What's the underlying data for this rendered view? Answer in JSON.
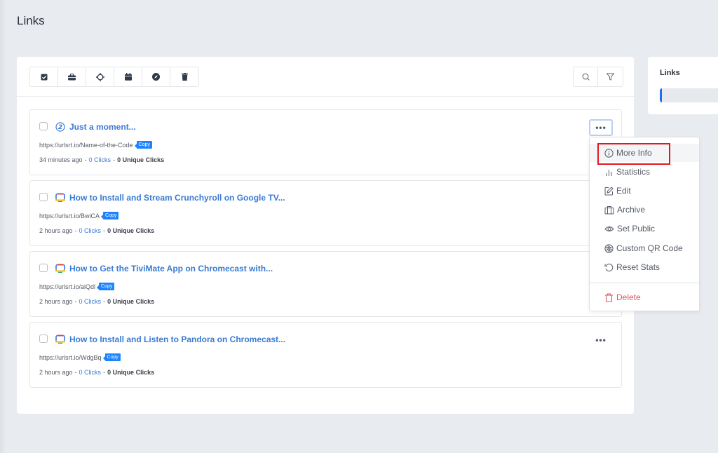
{
  "page": {
    "title": "Links"
  },
  "toolbar": {
    "buttons": [
      {
        "name": "select-all",
        "icon": "checkbox-icon"
      },
      {
        "name": "campaign",
        "icon": "briefcase-icon"
      },
      {
        "name": "pixels",
        "icon": "crosshair-icon"
      },
      {
        "name": "schedule",
        "icon": "calendar-icon"
      },
      {
        "name": "explore",
        "icon": "compass-icon"
      },
      {
        "name": "delete",
        "icon": "trash-icon"
      }
    ],
    "search_icon": "search-icon",
    "filter_icon": "filter-icon"
  },
  "links": [
    {
      "favicon": "custom-circle-icon",
      "title": "Just a moment...",
      "url": "https://urlsrt.io/Name-of-the-Code",
      "copy_label": "Copy",
      "time": "34 minutes ago",
      "clicks": "0 Clicks",
      "unique_clicks": "0 Unique Clicks",
      "menu_open": true
    },
    {
      "favicon": "google-tv-icon",
      "title": "How to Install and Stream Crunchyroll on Google TV...",
      "url": "https://urlsrt.io/BwiCA",
      "copy_label": "Copy",
      "time": "2 hours ago",
      "clicks": "0 Clicks",
      "unique_clicks": "0 Unique Clicks",
      "menu_open": false
    },
    {
      "favicon": "google-tv-icon",
      "title": "How to Get the TiviMate App on Chromecast with...",
      "url": "https://urlsrt.io/aiQdl",
      "copy_label": "Copy",
      "time": "2 hours ago",
      "clicks": "0 Clicks",
      "unique_clicks": "0 Unique Clicks",
      "menu_open": false
    },
    {
      "favicon": "google-tv-icon",
      "title": "How to Install and Listen to Pandora on Chromecast...",
      "url": "https://urlsrt.io/WdgBq",
      "copy_label": "Copy",
      "time": "2 hours ago",
      "clicks": "0 Clicks",
      "unique_clicks": "0 Unique Clicks",
      "menu_open": false
    }
  ],
  "separator": "-",
  "dropdown": {
    "items": [
      {
        "label": "More Info",
        "icon": "info-icon",
        "highlighted": true
      },
      {
        "label": "Statistics",
        "icon": "bar-chart-icon"
      },
      {
        "label": "Edit",
        "icon": "edit-icon"
      },
      {
        "label": "Archive",
        "icon": "archive-icon"
      },
      {
        "label": "Set Public",
        "icon": "eye-icon"
      },
      {
        "label": "Custom QR Code",
        "icon": "aperture-icon"
      },
      {
        "label": "Reset Stats",
        "icon": "reset-icon"
      }
    ],
    "delete": {
      "label": "Delete",
      "icon": "trash-icon"
    }
  },
  "side_panel": {
    "title": "Links",
    "usage_fraction": 0.03
  },
  "colors": {
    "accent": "#3a7bd5",
    "copy_badge": "#1d84ff",
    "danger": "#e05561",
    "highlight": "#e5161e",
    "progress": "#1d6ef5"
  }
}
